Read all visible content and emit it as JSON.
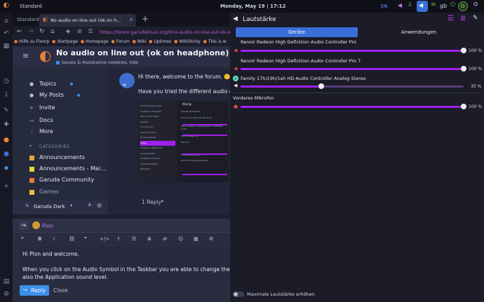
{
  "topbar": {
    "workspace": "Standard",
    "clock": "Monday, May 19 | 17:12",
    "lang": "EN",
    "user_initial": "D",
    "gb_label": "gb"
  },
  "browser": {
    "inactive_tab": "Standard",
    "active_tab": "No audio on line out (ok on h...",
    "url": "https://forum.garudalinux.org/t/no-audio-on-line-out-ok-on-headphone",
    "bookmarks": [
      "Hilfe zu Floorp",
      "Startpage",
      "Homepage",
      "Forum",
      "Wiki",
      "Uptimes",
      "WikiSticky",
      "This is w"
    ]
  },
  "forum": {
    "title": "No audio on line out (ok on headphone)",
    "category": "Issues & Assistance",
    "tags": "newbies, kde",
    "nav": [
      "Topics",
      "My Posts",
      "Invite",
      "Docs",
      "More"
    ],
    "categories_header": "CATEGORIES",
    "categories": [
      {
        "label": "Announcements",
        "color": "#e8a13a"
      },
      {
        "label": "Announcements - Mai...",
        "color": "#e3d93c"
      },
      {
        "label": "Garuda Community",
        "color": "#e27d3b"
      },
      {
        "label": "Games",
        "color": "#e8c33a"
      }
    ],
    "theme_label": "Garuda Dark",
    "avatar_label": "dr",
    "post_line1": "Hi there, welcome to the forum. 🙂",
    "post_line2": "Have you tried the different audio opt",
    "replies": "1 Reply",
    "thumb": {
      "header": "Klang",
      "left_items": [
        "Schnelleinstellungen",
        "Eingabe & Ausgabe",
        "Maus & Touchpad",
        "Tastatur",
        "Touchscreen",
        "Gamecontroller",
        "Zeichentablett",
        "Klang",
        "Anzeige & Bildschirm",
        "Zugangshilfen",
        "Eingabefunktionen",
        "Geschwindigkeit",
        "Netzwerk"
      ],
      "right_items": [
        "Wiedergabegeräte",
        "Family 17h/19h/1ah HD Audio",
        "Renoir Radeon High Definition HDMI/DP Audio",
        "Aufnahmegeräte",
        "Mikrofon",
        "Wiedergabegeräte",
        "Benachrichtigungsklänge"
      ]
    }
  },
  "composer": {
    "user": "Plon",
    "line1": "Hi Plon and welcome,",
    "line2": "When you click on the Audio Symbol in the Taskbar you are able to change the output",
    "line3": "also the Application sound level.",
    "reply_label": "Reply",
    "close_label": "Close"
  },
  "panel": {
    "title": "Lautstärke",
    "tab_devices": "Geräte",
    "tab_apps": "Anwendungen",
    "devices": [
      {
        "name": "Renoir Radeon High Definition Audio Controller Pro",
        "percent": "100 %",
        "level": 1.0,
        "selected": false,
        "muted": true
      },
      {
        "name": "Renoir Radeon High Definition Audio Controller Pro 7",
        "percent": "100 %",
        "level": 1.0,
        "selected": false,
        "muted": true
      },
      {
        "name": "Family 17h/19h/1ah HD Audio Controller Analog Stereo",
        "percent": "35 %",
        "level": 0.35,
        "selected": true,
        "muted": false
      }
    ],
    "mic": {
      "name": "Vorderes Mikrofon",
      "percent": "100 %",
      "level": 1.0,
      "muted": true
    },
    "max_volume_label": "Maximale Lautstärke erhöhen"
  }
}
